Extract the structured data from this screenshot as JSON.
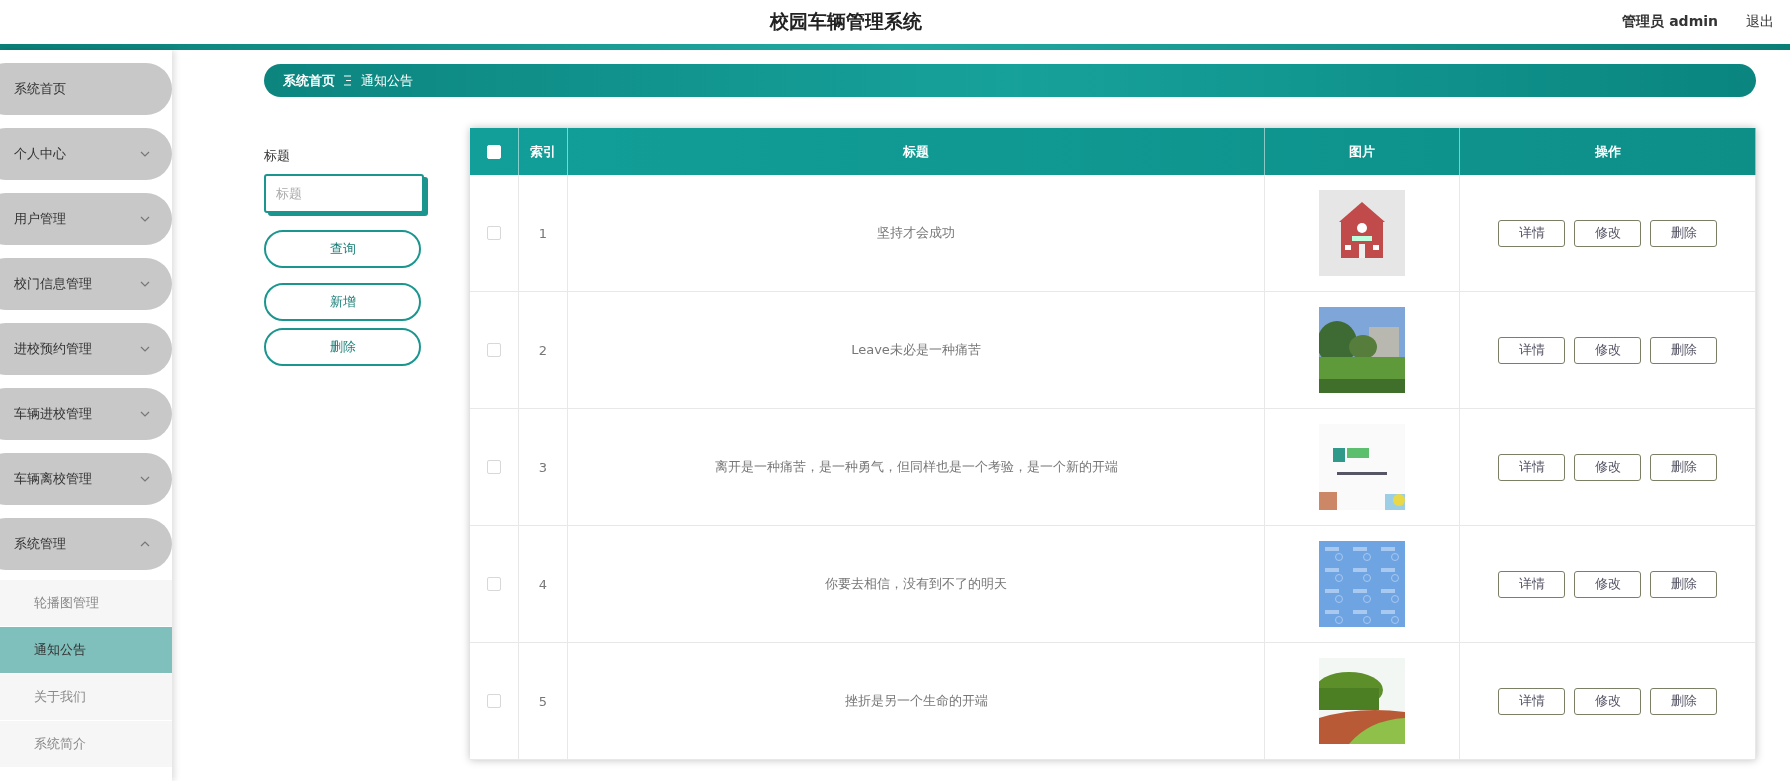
{
  "header": {
    "title": "校园车辆管理系统",
    "user_label": "管理员 admin",
    "logout": "退出"
  },
  "sidebar": {
    "items": [
      {
        "label": "系统首页",
        "kind": "link"
      },
      {
        "label": "个人中心",
        "kind": "menu",
        "expanded": false
      },
      {
        "label": "用户管理",
        "kind": "menu",
        "expanded": false
      },
      {
        "label": "校门信息管理",
        "kind": "menu",
        "expanded": false
      },
      {
        "label": "进校预约管理",
        "kind": "menu",
        "expanded": false
      },
      {
        "label": "车辆进校管理",
        "kind": "menu",
        "expanded": false
      },
      {
        "label": "车辆离校管理",
        "kind": "menu",
        "expanded": false
      },
      {
        "label": "系统管理",
        "kind": "menu",
        "expanded": true,
        "children": [
          {
            "label": "轮播图管理",
            "selected": false
          },
          {
            "label": "通知公告",
            "selected": true
          },
          {
            "label": "关于我们",
            "selected": false
          },
          {
            "label": "系统简介",
            "selected": false
          }
        ]
      }
    ]
  },
  "breadcrumb": [
    "系统首页",
    "通知公告"
  ],
  "search": {
    "label": "标题",
    "placeholder": "标题",
    "buttons": [
      "查询",
      "新增",
      "删除"
    ]
  },
  "table": {
    "select_all": {
      "checked": false
    },
    "columns": [
      {
        "label": "索引",
        "kind": "index"
      },
      {
        "label": "标题",
        "kind": "title"
      },
      {
        "label": "图片",
        "kind": "picture"
      },
      {
        "label": "操作",
        "kind": "actions"
      }
    ],
    "rows": [
      {
        "checked": false,
        "index": "1",
        "title": "坚持才会成功",
        "actions": [
          "详情",
          "修改",
          "删除"
        ]
      },
      {
        "checked": false,
        "index": "2",
        "title": "Leave未必是一种痛苦",
        "actions": [
          "详情",
          "修改",
          "删除"
        ]
      },
      {
        "checked": false,
        "index": "3",
        "title": "离开是一种痛苦，是一种勇气，但同样也是一个考验，是一个新的开端",
        "actions": [
          "详情",
          "修改",
          "删除"
        ]
      },
      {
        "checked": false,
        "index": "4",
        "title": "你要去相信，没有到不了的明天",
        "actions": [
          "详情",
          "修改",
          "删除"
        ]
      },
      {
        "checked": false,
        "index": "5",
        "title": "挫折是另一个生命的开端",
        "actions": [
          "详情",
          "修改",
          "删除"
        ]
      }
    ]
  }
}
